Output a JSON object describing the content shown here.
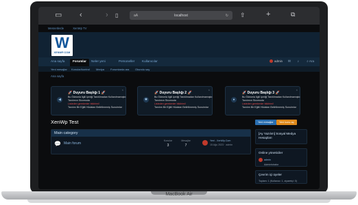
{
  "device": {
    "label": "MacBook Air"
  },
  "browser": {
    "address_left": "aA",
    "address": "localhost",
    "back_icon": "chevron-left-icon",
    "forward_icon": "chevron-right-icon"
  },
  "topcrumbs": [
    "Mesnetlerde",
    "XenWp TV"
  ],
  "logo": {
    "text": "XENWP.COM",
    "letter": "W"
  },
  "nav": {
    "items": [
      "Ana sayfa",
      "Forumlar",
      "Neler yeni",
      "Personeller",
      "Kullanıcılar"
    ],
    "active_index": 1,
    "user": "admin",
    "search": "Ara"
  },
  "subnav": [
    "Yeni mesajlar",
    "Konular/kontrol",
    "Medya",
    "Forumlarda ara",
    "Okundu say"
  ],
  "breadcrumb": "Ana sayfa",
  "cards": [
    {
      "title": "🚀 Duyuru Başlığı 1 🚀",
      "line1": "Bu Ödeonla ilgili içeriği Tanıtılmadan Kullanılmamıştır.",
      "line2": "Tanıtımın Sicomoda",
      "line3": "Listeden gerekenler bildirimi!",
      "line4": "Tanıtım Bir Eğitli Hüdalan Belirtilmemiş Sunuimlar",
      "icon": "megaphone-icon"
    },
    {
      "title": "🚀 Duyuru Başlığı 2 🚀",
      "line1": "Bu Ödeonla ilgili içeriği Tanıtılmadan Kullanılmamıştır.",
      "line2": "Tanıtımın Sicomoda",
      "line3": "Listeden gerekenler bildirimi!",
      "line4": "Tanıtım Bir Eğitli Hüdalan Belirtilmemiş Sunuimlar",
      "icon": "settings-icon"
    },
    {
      "title": "🚀 Duyuru Başlığı 3 🚀",
      "line1": "Bu Ödeonla ilgili içeriği Tanıtılmadan Kullanılmamıştır.",
      "line2": "Tanıtımın Sicomoda",
      "line3": "Listeden gerekenler bildirimi!",
      "line4": "Tanıtım Bir Eğitli Hüdalan Belirtilmemiş Sunuimlar",
      "icon": "users-icon"
    }
  ],
  "main": {
    "title": "XenWp Test",
    "new_post": "Yeni mesajlar",
    "new_topic": "Yeni konu aç",
    "category": "Main category",
    "forum": {
      "name": "Main forum",
      "threads_label": "Konular",
      "threads": "3",
      "messages_label": "Mesajlar",
      "messages": "7",
      "last_title": "Yeni - XenWp.Com",
      "last_meta": "15 Ağu 2023 · admin"
    }
  },
  "sidebar": {
    "box1_title": "[Ay Yazılım] Sosyal Medya Hesapları",
    "box2_title": "Online yöneticiler",
    "box2_user": "admin",
    "box2_role": "Administrator",
    "box3_title": "Çevrim içi üyeler",
    "box3_row": "Toplam: 1 (Kullanıcı: 1, ziyaretçi: 0)"
  }
}
